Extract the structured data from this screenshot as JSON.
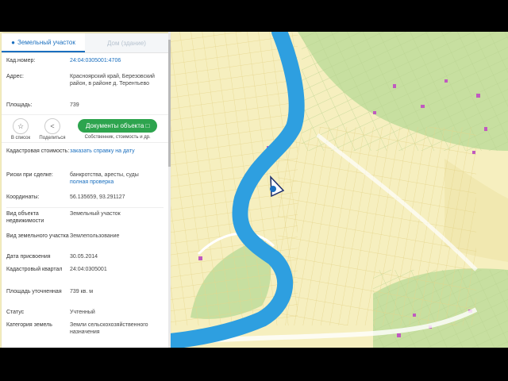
{
  "tabs": {
    "land": "Земельный участок",
    "building": "Дом (здание)"
  },
  "info": {
    "cadnum_label": "Кад.номер:",
    "cadnum_value": "24:04:0305001:4706",
    "address_label": "Адрес:",
    "address_value": "Красноярский край, Березовский район, в районе д. Терентьево",
    "area_label": "Площадь:",
    "area_value": "739"
  },
  "actions": {
    "list_label": "В список",
    "share_label": "Поделиться",
    "docs_button": "Документы объекта",
    "docs_sub": "Собственник, стоимость и др."
  },
  "details": {
    "cost_label": "Кадастровая стоимость:",
    "cost_value": "заказать справку на дату",
    "risk_label": "Риски при сделке:",
    "risk_value": "банкротства, аресты, суды",
    "risk_link": "полная проверка",
    "coords_label": "Координаты:",
    "coords_value": "56.135659, 93.291127",
    "objtype_label": "Вид объекта недвижимости",
    "objtype_value": "Земельный участок",
    "landtype_label": "Вид земельного участка",
    "landtype_value": "Землепользование",
    "date_label": "Дата присвоения",
    "date_value": "30.05.2014",
    "quarter_label": "Кадастровый квартал",
    "quarter_value": "24:04:0305001",
    "precise_label": "Площадь уточненная",
    "precise_value": "739 кв. м",
    "status_label": "Статус",
    "status_value": "Учтенный",
    "category_label": "Категория земель",
    "category_value": "Земли сельскохозяйственного назначения"
  },
  "colors": {
    "map_bg": "#f6efbf",
    "river": "#2e9fe0",
    "forest": "#c7dfa0",
    "accent": "#1a6fbf",
    "button": "#2da44e"
  }
}
